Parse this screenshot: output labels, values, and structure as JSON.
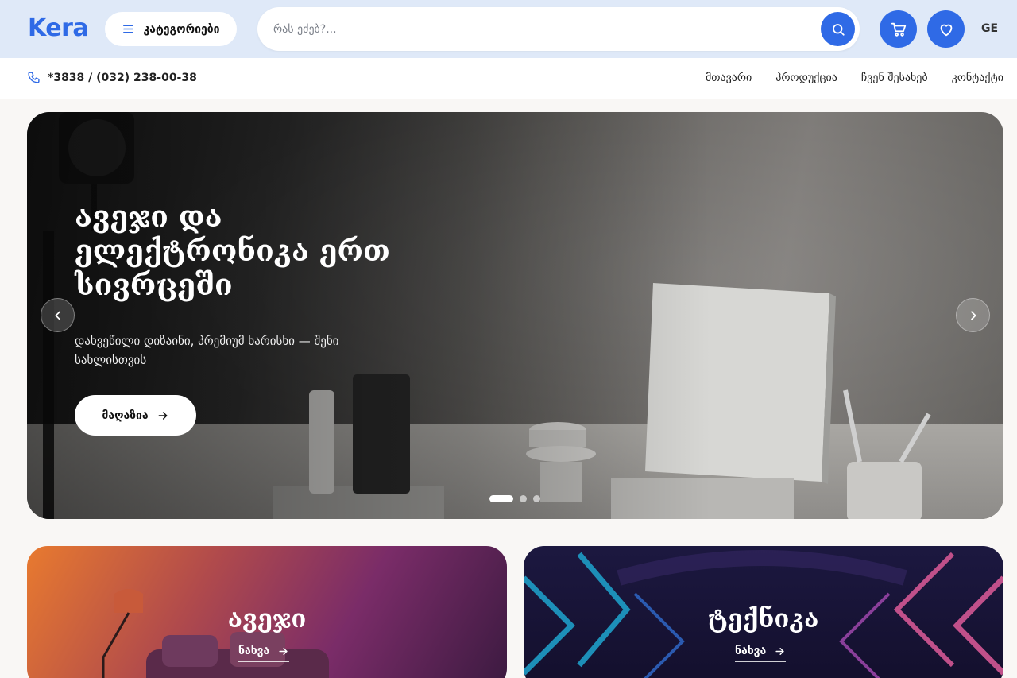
{
  "header": {
    "logo": "Kera",
    "categories_button": "კატეგორიები",
    "search_placeholder": "რას ეძებ?...",
    "language": "GE",
    "accent_color": "#2f6ae6",
    "icons": [
      "menu-icon",
      "search-icon",
      "cart-icon",
      "heart-icon"
    ]
  },
  "subbar": {
    "phone": "*3838 / (032) 238-00-38",
    "nav": [
      "მთავარი",
      "პროდუქცია",
      "ჩვენ შესახებ",
      "კონტაქტი"
    ]
  },
  "hero": {
    "title": "ავეჯი და ელექტრონიკა ერთ სივრცეში",
    "subtitle": "დახვეწილი დიზაინი, პრემიუმ ხარისხი — შენი სახლისთვის",
    "button": "მაღაზია",
    "slides_total": 3,
    "active_slide": 1
  },
  "cards": [
    {
      "title": "ავეჯი",
      "link": "ნახვა"
    },
    {
      "title": "ტექნიკა",
      "link": "ნახვა"
    }
  ]
}
